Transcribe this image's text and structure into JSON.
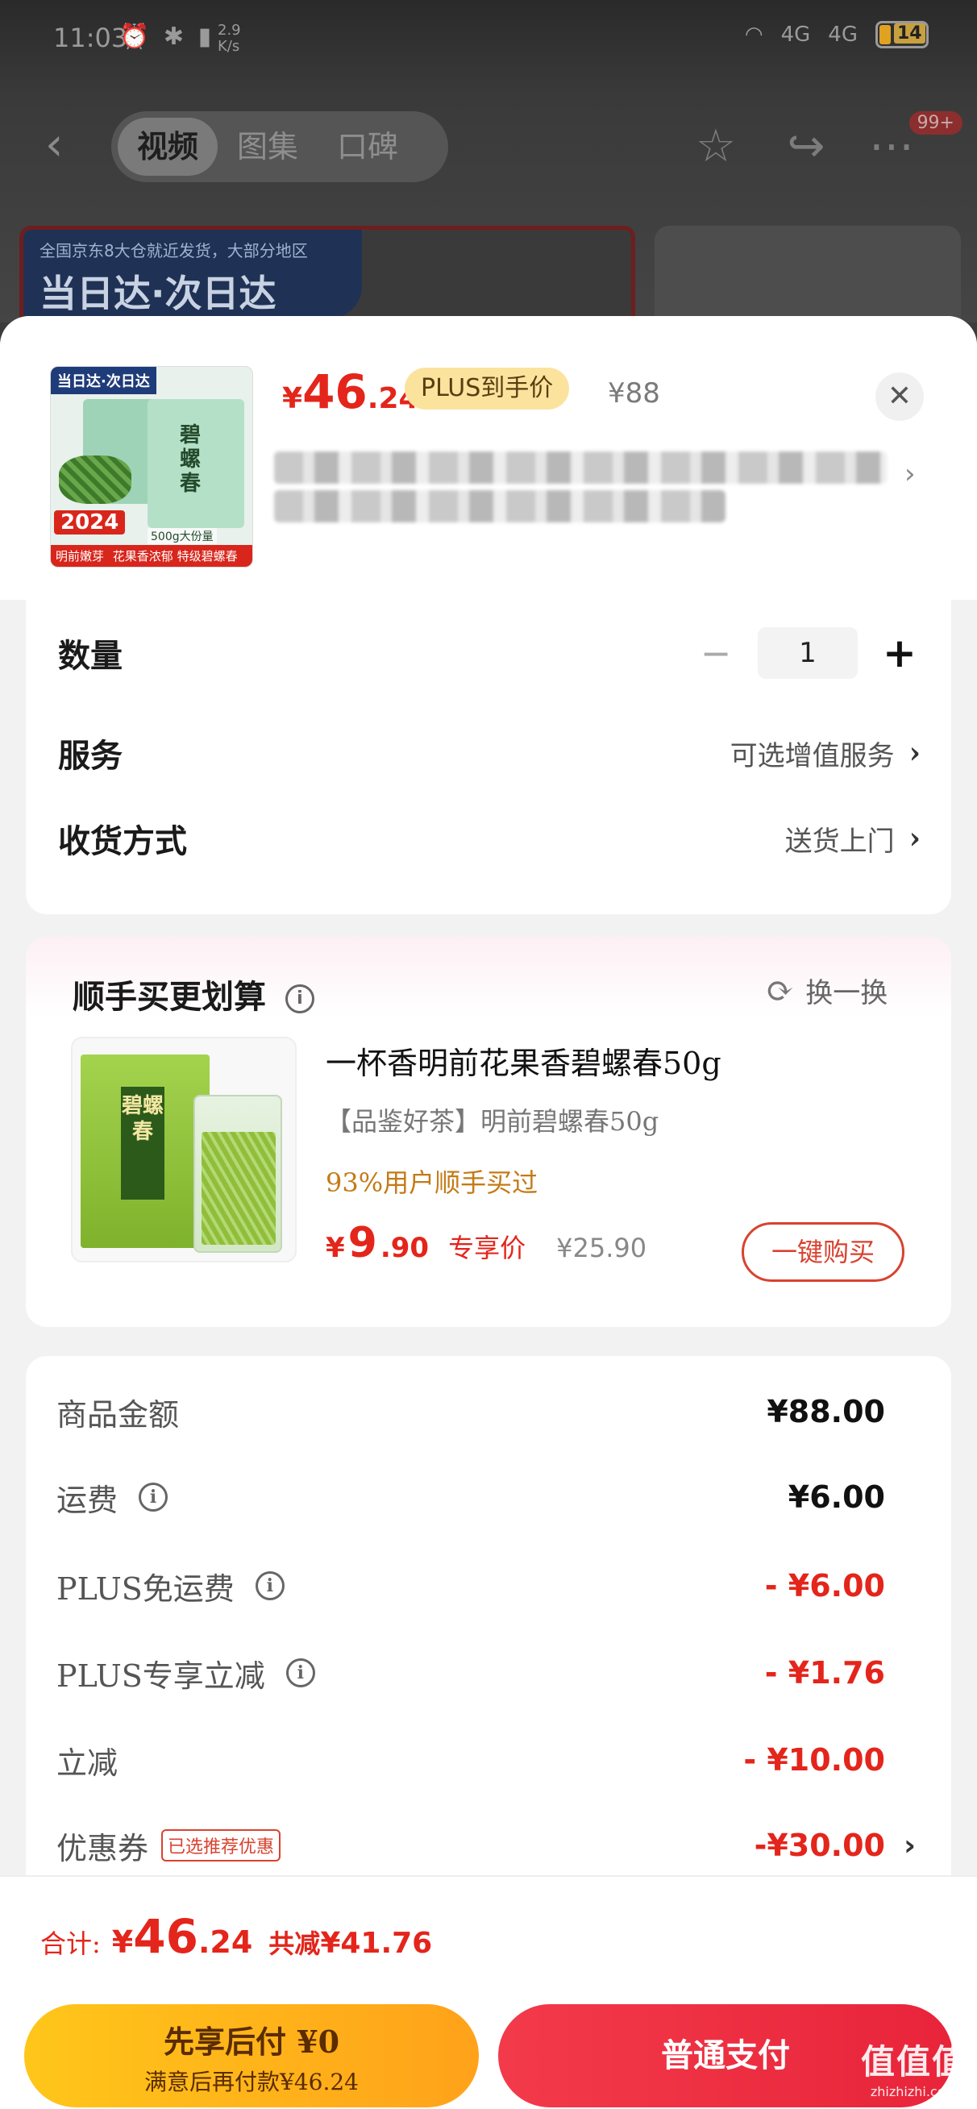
{
  "status_bar": {
    "time": "11:03",
    "net_speed": "2.9\nK/s",
    "left_icons": "⏰ ✱ ▮",
    "signal_label_1": "4G",
    "signal_label_2": "4G",
    "battery": "14"
  },
  "nav": {
    "tabs": [
      {
        "label": "视频",
        "active": true
      },
      {
        "label": "图集",
        "active": false
      },
      {
        "label": "口碑",
        "active": false
      }
    ],
    "badge": "99+"
  },
  "promo": {
    "sub": "全国京东8大仓就近发货，大部分地区",
    "main": "当日达·次日达"
  },
  "product": {
    "thumb_tag": "当日达·次日达",
    "thumb_name": "碧螺春",
    "thumb_year": "2024",
    "thumb_year_sub": "明前嫩芽",
    "thumb_size": "500g大份量",
    "thumb_bottom": "花果香浓郁 特级碧螺春",
    "price_yen": "¥",
    "price_int": "46",
    "price_dec": ".24",
    "plus_tag": "PLUS到手价",
    "orig_price": "¥88",
    "close": "✕"
  },
  "options": {
    "quantity_label": "数量",
    "quantity_value": "1",
    "minus": "−",
    "plus": "+",
    "service_label": "服务",
    "service_value": "可选增值服务",
    "delivery_label": "收货方式",
    "delivery_value": "送货上门"
  },
  "bundle": {
    "title": "顺手买更划算",
    "refresh": "换一换",
    "box_label": "碧螺春",
    "name": "一杯香明前花果香碧螺春50g",
    "desc": "【品鉴好茶】明前碧螺春50g",
    "social": "93%用户顺手买过",
    "price_yen": "¥",
    "price_int": "9",
    "price_dec": ".90",
    "price_tag": "专享价",
    "orig_price": "¥25.90",
    "buy": "一键购买"
  },
  "costs": {
    "rows": [
      {
        "label": "商品金额",
        "value": "¥88.00",
        "info": false
      },
      {
        "label": "运费",
        "value": "¥6.00",
        "info": true
      },
      {
        "label": "PLUS免运费",
        "value": "- ¥6.00",
        "info": true
      },
      {
        "label": "PLUS专享立减",
        "value": "- ¥1.76",
        "info": true
      },
      {
        "label": "立减",
        "value": "- ¥10.00",
        "info": false
      },
      {
        "label": "优惠券",
        "value": "-¥30.00",
        "info": false
      }
    ],
    "coupon_tag": "已选推荐优惠"
  },
  "total": {
    "label": "合计:",
    "yen": "¥",
    "int": "46",
    "dec": ".24",
    "save_label": "共减",
    "save": "¥41.76"
  },
  "actions": {
    "later_main": "先享后付 ¥0",
    "later_sub": "满意后再付款¥46.24",
    "pay": "普通支付"
  },
  "watermark": {
    "main": "值值值",
    "sub": "zhizhizhi.com"
  },
  "colors": {
    "accent_red": "#e4251b",
    "plus_gold": "#fbe39e",
    "pay_red": "#e8243a",
    "later_yellow": "#ffb41a"
  }
}
